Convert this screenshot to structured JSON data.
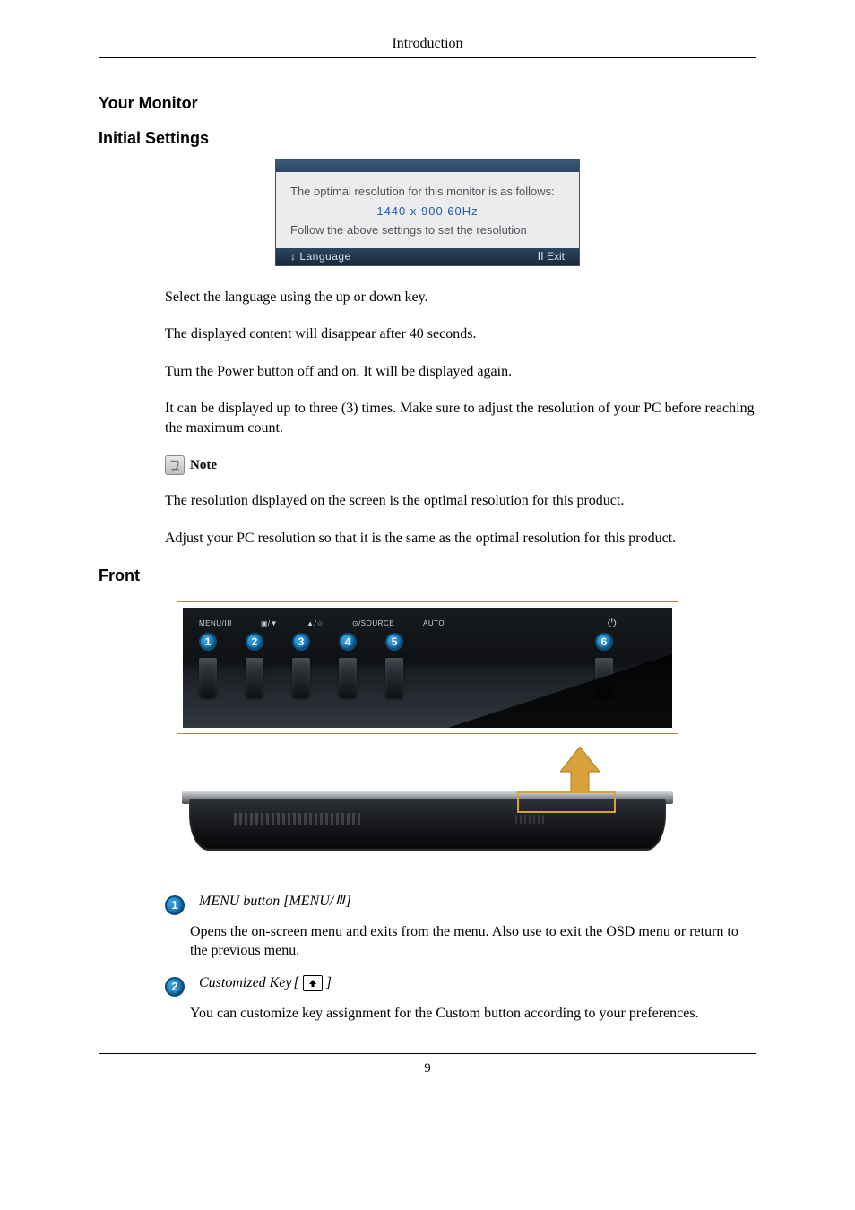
{
  "header": {
    "title": "Introduction"
  },
  "sections": {
    "your_monitor": "Your Monitor",
    "initial_settings": "Initial Settings",
    "front": "Front"
  },
  "osd": {
    "line1": "The optimal resolution for this monitor is as follows:",
    "resolution": "1440 x 900 60Hz",
    "line2": "Follow the above settings to set the resolution",
    "footer_left": "↕ Language",
    "footer_right": "ⅠⅠ Exit"
  },
  "body": {
    "p1": "Select the language using the up or down key.",
    "p2": "The displayed content will disappear after 40 seconds.",
    "p3": "Turn the Power button off and on. It will be displayed again.",
    "p4": "It can be displayed up to three (3) times. Make sure to adjust the resolution of your PC before reaching the maximum count.",
    "note_label": "Note",
    "p5": "The resolution displayed on the screen is the optimal resolution for this product.",
    "p6": "Adjust your PC resolution so that it is the same as the optimal resolution for this product."
  },
  "front_panel": {
    "labels": {
      "b1": "MENU/ⅠⅠⅠ",
      "b2": "▣/▼",
      "b3": "▲/☆",
      "b4": "⊙/SOURCE",
      "b5": "AUTO"
    },
    "numbers": [
      "1",
      "2",
      "3",
      "4",
      "5",
      "6"
    ]
  },
  "defs": {
    "d1": {
      "num": "1",
      "title_prefix": "MENU button [MENU/",
      "title_suffix": "]",
      "text": "Opens the on-screen menu and exits from the menu. Also use to exit the OSD menu or return to the previous menu."
    },
    "d2": {
      "num": "2",
      "title_prefix": "Customized Key",
      "title_open": "[",
      "title_close": "]",
      "text": "You can customize key assignment for the Custom button according to your preferences."
    }
  },
  "footer": {
    "page": "9"
  }
}
